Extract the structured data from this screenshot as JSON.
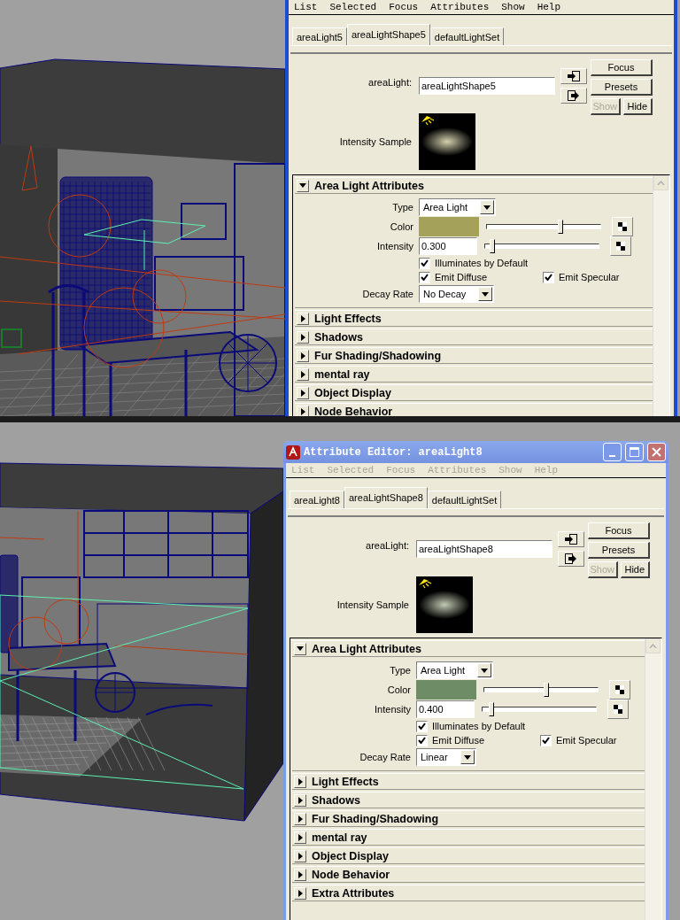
{
  "editors": [
    {
      "menu": [
        "List",
        "Selected",
        "Focus",
        "Attributes",
        "Show",
        "Help"
      ],
      "menu_disabled": false,
      "tabs": [
        {
          "label": "areaLight5",
          "selected": false
        },
        {
          "label": "areaLightShape5",
          "selected": true
        },
        {
          "label": "defaultLightSet",
          "selected": false
        }
      ],
      "node_label": "areaLight:",
      "node_value": "areaLightShape5",
      "buttons": [
        {
          "label": "Focus",
          "disabled": false
        },
        {
          "label": "Presets",
          "disabled": false
        },
        {
          "label": "Show",
          "disabled": true
        },
        {
          "label": "Hide",
          "disabled": false
        }
      ],
      "sample_label": "Intensity Sample",
      "sections": [
        {
          "title": "Area Light Attributes",
          "expanded": true,
          "attributes": [
            {
              "kind": "dropdown",
              "label": "Type",
              "value": "Area Light"
            },
            {
              "kind": "color",
              "label": "Color",
              "color": "#a4a25a",
              "level": 0.65
            },
            {
              "kind": "slider",
              "label": "Intensity",
              "value": "0.300",
              "level": 0.06
            },
            {
              "kind": "checkboxes",
              "items": [
                {
                  "label": "Illuminates by Default",
                  "checked": true
                }
              ]
            },
            {
              "kind": "checkboxes",
              "items": [
                {
                  "label": "Emit Diffuse",
                  "checked": true
                },
                {
                  "label": "Emit Specular",
                  "checked": true
                }
              ]
            },
            {
              "kind": "dropdown",
              "label": "Decay Rate",
              "value": "No Decay"
            }
          ]
        },
        {
          "title": "Light Effects",
          "expanded": false
        },
        {
          "title": "Shadows",
          "expanded": false
        },
        {
          "title": "Fur Shading/Shadowing",
          "expanded": false
        },
        {
          "title": "mental ray",
          "expanded": false
        },
        {
          "title": "Object Display",
          "expanded": false
        },
        {
          "title": "Node Behavior",
          "expanded": false
        }
      ]
    },
    {
      "title": "Attribute Editor: areaLight8",
      "menu": [
        "List",
        "Selected",
        "Focus",
        "Attributes",
        "Show",
        "Help"
      ],
      "menu_disabled": true,
      "tabs": [
        {
          "label": "areaLight8",
          "selected": false
        },
        {
          "label": "areaLightShape8",
          "selected": true
        },
        {
          "label": "defaultLightSet",
          "selected": false
        }
      ],
      "node_label": "areaLight:",
      "node_value": "areaLightShape8",
      "buttons": [
        {
          "label": "Focus",
          "disabled": false
        },
        {
          "label": "Presets",
          "disabled": false
        },
        {
          "label": "Show",
          "disabled": true
        },
        {
          "label": "Hide",
          "disabled": false
        }
      ],
      "sample_label": "Intensity Sample",
      "sections": [
        {
          "title": "Area Light Attributes",
          "expanded": true,
          "attributes": [
            {
              "kind": "dropdown",
              "label": "Type",
              "value": "Area Light"
            },
            {
              "kind": "color",
              "label": "Color",
              "color": "#6e8c66",
              "level": 0.55
            },
            {
              "kind": "slider",
              "label": "Intensity",
              "value": "0.400",
              "level": 0.08
            },
            {
              "kind": "checkboxes",
              "items": [
                {
                  "label": "Illuminates by Default",
                  "checked": true
                }
              ]
            },
            {
              "kind": "checkboxes",
              "items": [
                {
                  "label": "Emit Diffuse",
                  "checked": true
                },
                {
                  "label": "Emit Specular",
                  "checked": true
                }
              ]
            },
            {
              "kind": "dropdown",
              "label": "Decay Rate",
              "value": "Linear"
            }
          ]
        },
        {
          "title": "Light Effects",
          "expanded": false
        },
        {
          "title": "Shadows",
          "expanded": false
        },
        {
          "title": "Fur Shading/Shadowing",
          "expanded": false
        },
        {
          "title": "mental ray",
          "expanded": false
        },
        {
          "title": "Object Display",
          "expanded": false
        },
        {
          "title": "Node Behavior",
          "expanded": false
        },
        {
          "title": "Extra Attributes",
          "expanded": false
        }
      ]
    }
  ]
}
